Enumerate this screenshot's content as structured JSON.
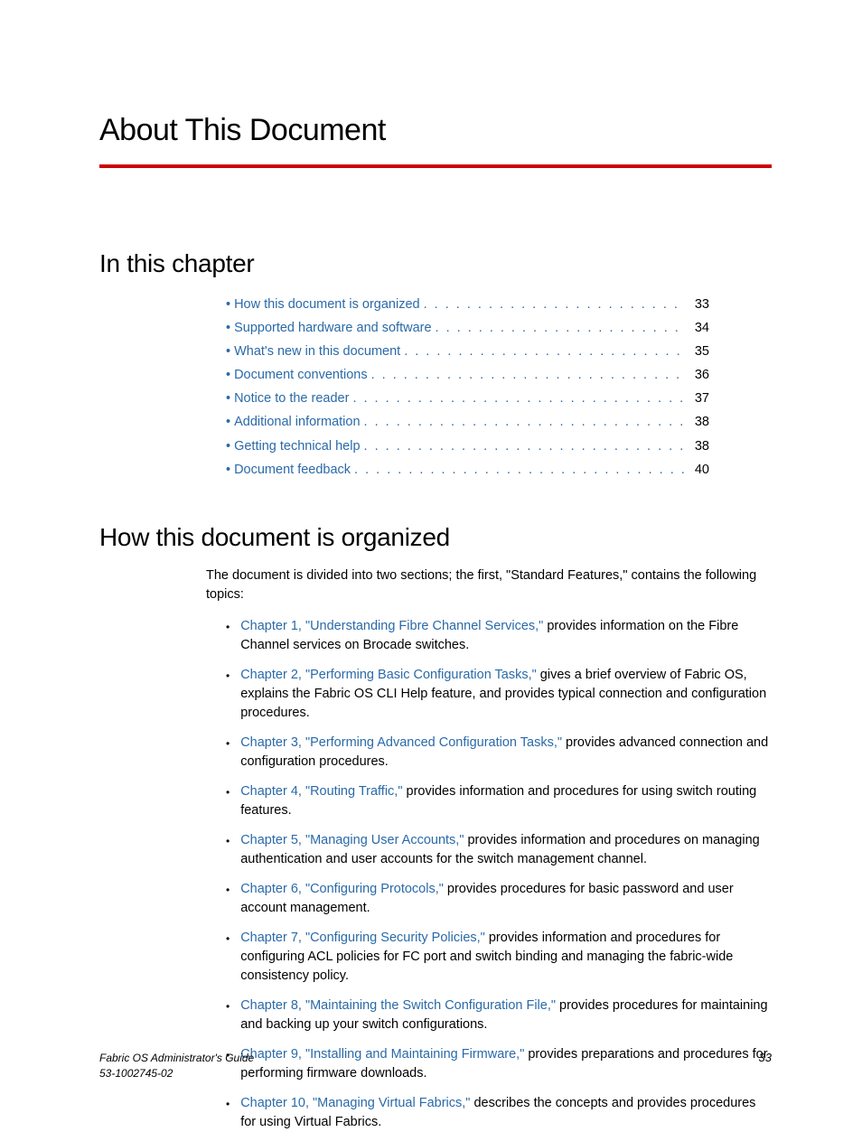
{
  "title": "About This Document",
  "sections": {
    "in_chapter": "In this chapter",
    "organized": "How this document is organized"
  },
  "toc": [
    {
      "label": "How this document is organized",
      "page": "33"
    },
    {
      "label": "Supported hardware and software",
      "page": "34"
    },
    {
      "label": "What's new in this document",
      "page": "35"
    },
    {
      "label": "Document conventions",
      "page": "36"
    },
    {
      "label": "Notice to the reader",
      "page": "37"
    },
    {
      "label": "Additional information",
      "page": "38"
    },
    {
      "label": "Getting technical help",
      "page": "38"
    },
    {
      "label": "Document feedback",
      "page": "40"
    }
  ],
  "intro": "The document is divided into two sections; the first, \"Standard Features,\" contains the following topics:",
  "chapters": [
    {
      "link": "Chapter 1, \"Understanding Fibre Channel Services,\"",
      "rest": " provides information on the Fibre Channel services on Brocade switches."
    },
    {
      "link": "Chapter 2, \"Performing Basic Configuration Tasks,\"",
      "rest": " gives a brief overview of Fabric OS, explains the Fabric OS CLI Help feature, and provides typical connection and configuration procedures."
    },
    {
      "link": "Chapter 3, \"Performing Advanced Configuration Tasks,\"",
      "rest": " provides advanced connection and configuration procedures."
    },
    {
      "link": "Chapter 4, \"Routing Traffic,\"",
      "rest": " provides information and procedures for using switch routing features."
    },
    {
      "link": "Chapter 5, \"Managing User Accounts,\"",
      "rest": " provides information and procedures on managing authentication and user accounts for the switch management channel."
    },
    {
      "link": "Chapter 6, \"Configuring Protocols,\"",
      "rest": " provides procedures for basic password and user account management."
    },
    {
      "link": "Chapter 7, \"Configuring Security Policies,\"",
      "rest": " provides information and procedures for configuring ACL policies for FC port and switch binding and managing the fabric-wide consistency policy."
    },
    {
      "link": "Chapter 8, \"Maintaining the Switch Configuration File,\"",
      "rest": " provides procedures for maintaining and backing up your switch configurations."
    },
    {
      "link": "Chapter 9, \"Installing and Maintaining Firmware,\"",
      "rest": " provides preparations and procedures for performing firmware downloads."
    },
    {
      "link": "Chapter 10, \"Managing Virtual Fabrics,\"",
      "rest": " describes the concepts and provides procedures for using Virtual Fabrics."
    }
  ],
  "footer": {
    "title": "Fabric OS Administrator's Guide",
    "doc_num": "53-1002745-02",
    "page": "33"
  }
}
